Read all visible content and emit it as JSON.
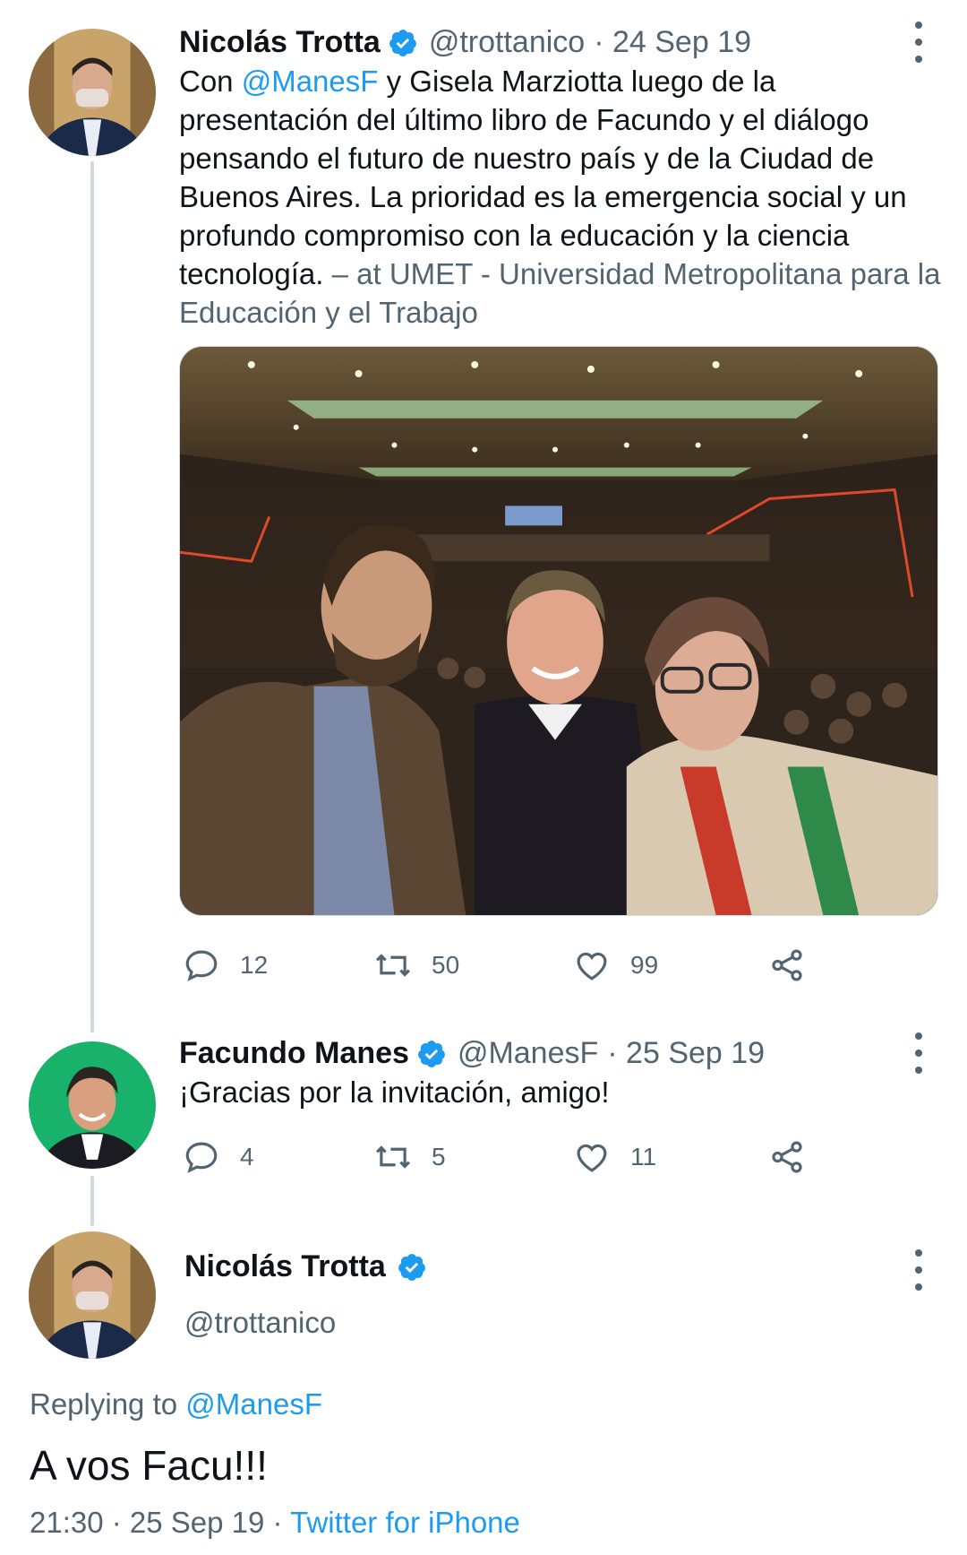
{
  "tweets": [
    {
      "name": "Nicolás Trotta",
      "handle": "@trottanico",
      "date": "· 24 Sep 19",
      "text_parts": {
        "p1": "Con ",
        "mention": "@ManesF",
        "p2": " y Gisela Marziotta luego de la presentación del último libro de Facundo y el diálogo pensando el futuro de nuestro país y de la Ciudad de Buenos Aires. La prioridad es la emergencia social y un profundo compromiso con la educación y la ciencia tecnología. ",
        "location": "– at UMET - Universidad Metropolitana para la Educación y el Trabajo"
      },
      "replies": "12",
      "retweets": "50",
      "likes": "99"
    },
    {
      "name": "Facundo Manes",
      "handle": "@ManesF",
      "date": "· 25 Sep 19",
      "text": "¡Gracias por la invitación, amigo!",
      "replies": "4",
      "retweets": "5",
      "likes": "11"
    }
  ],
  "main_tweet": {
    "name": "Nicolás Trotta",
    "handle": "@trottanico",
    "replying_prefix": "Replying to ",
    "replying_to": "@ManesF",
    "text": "A vos Facu!!!",
    "time": "21:30 · 25 Sep 19 · ",
    "source": "Twitter for iPhone"
  },
  "icons": {
    "reply": "reply-icon",
    "retweet": "retweet-icon",
    "like": "heart-icon",
    "share": "share-icon",
    "verified": "verified-badge-icon",
    "more": "more-vertical-icon"
  },
  "colors": {
    "link": "#1d9bf0",
    "verified": "#1d9bf0",
    "secondary_text": "#536471",
    "thread_line": "#cfd9de"
  }
}
